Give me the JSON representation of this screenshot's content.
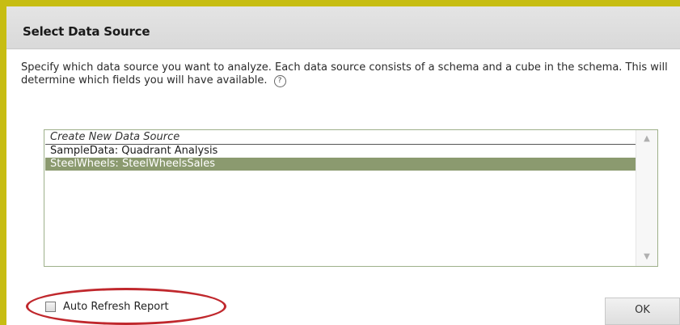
{
  "dialog": {
    "title": "Select Data Source",
    "description": "Specify which data source you want to analyze. Each data source consists of a schema and a cube in the schema. This will determine which fields you will have available.",
    "help_icon": "help-icon"
  },
  "datasource_list": {
    "items": [
      {
        "label": "Create New Data Source",
        "style": "italic"
      },
      {
        "label": "SampleData: Quadrant Analysis",
        "style": "normal"
      },
      {
        "label": "SteelWheels: SteelWheelsSales",
        "style": "selected"
      }
    ],
    "selected_value": "SteelWheels: SteelWheelsSales"
  },
  "options": {
    "auto_refresh_label": "Auto Refresh Report",
    "auto_refresh_checked": false
  },
  "buttons": {
    "ok_label": "OK"
  },
  "colors": {
    "border_accent": "#c7bd12",
    "selection": "#8b9a6f",
    "highlight_annotation": "#c0282d"
  }
}
